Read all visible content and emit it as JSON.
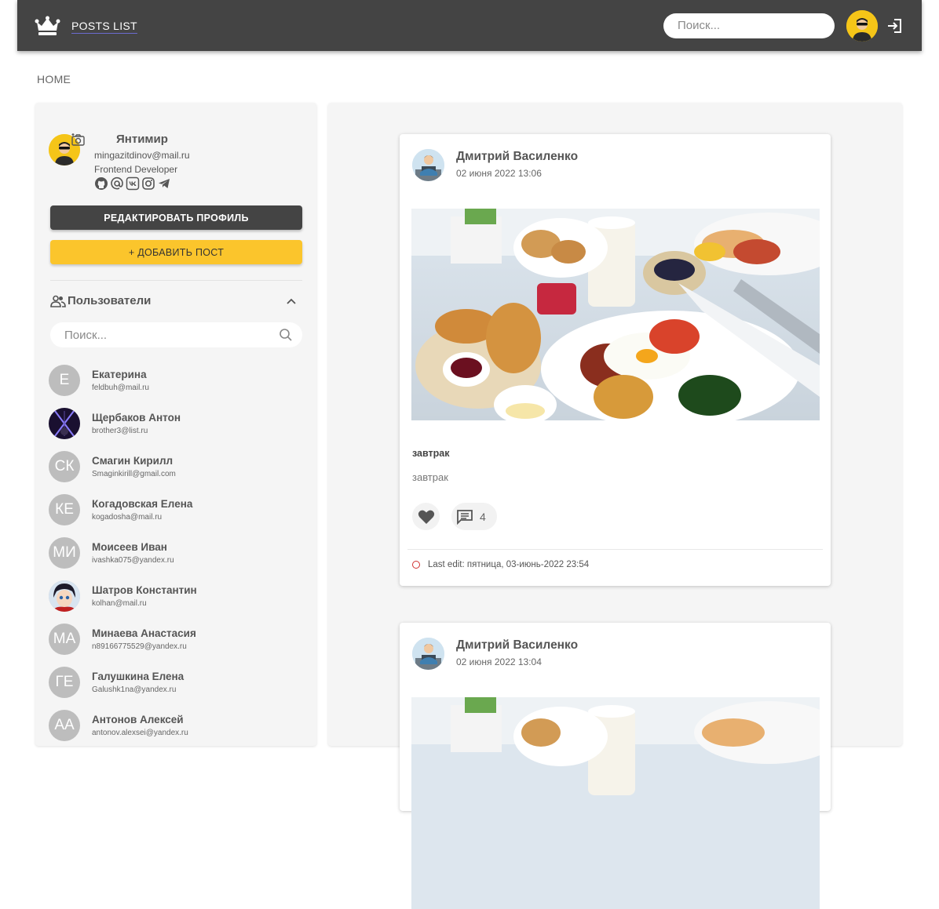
{
  "appbar": {
    "title": "POSTS LIST",
    "search_placeholder": "Поиск...",
    "icons": [
      "crown-logo-icon",
      "search-icon",
      "avatar",
      "logout-icon"
    ]
  },
  "breadcrumb": "HOME",
  "profile": {
    "name": "Янтимир",
    "email": "mingazitdinov@mail.ru",
    "role": "Frontend Developer",
    "socials": [
      "github-icon",
      "email-at-icon",
      "vk-icon",
      "instagram-icon",
      "telegram-icon"
    ],
    "edit_button": "РЕДАКТИРОВАТЬ ПРОФИЛЬ",
    "add_post_button": "+ ДОБАВИТЬ ПОСТ"
  },
  "users_section": {
    "title": "Пользователи",
    "search_placeholder": "Поиск...",
    "users": [
      {
        "name": "Екатерина",
        "email": "feldbuh@mail.ru",
        "initials": "Е",
        "photo": false
      },
      {
        "name": "Щербаков Антон",
        "email": "brother3@list.ru",
        "initials": "",
        "photo": "neon"
      },
      {
        "name": "Смагин Кирилл",
        "email": "Smaginkirill@gmail.com",
        "initials": "СК",
        "photo": false
      },
      {
        "name": "Когадовская Елена",
        "email": "kogadosha@mail.ru",
        "initials": "КЕ",
        "photo": false
      },
      {
        "name": "Моисеев Иван",
        "email": "ivashka075@yandex.ru",
        "initials": "МИ",
        "photo": false
      },
      {
        "name": "Шатров Константин",
        "email": "kolhan@mail.ru",
        "initials": "",
        "photo": "anime"
      },
      {
        "name": "Минаева Анастасия",
        "email": "n89166775529@yandex.ru",
        "initials": "МА",
        "photo": false
      },
      {
        "name": "Галушкина Елена",
        "email": "Galushk1na@yandex.ru",
        "initials": "ГЕ",
        "photo": false
      },
      {
        "name": "Антонов Алексей",
        "email": "antonov.alexsei@yandex.ru",
        "initials": "АА",
        "photo": false
      }
    ]
  },
  "posts": [
    {
      "author": "Дмитрий Василенко",
      "date": "02 июня 2022 13:06",
      "title": "завтрак",
      "text": "завтрак",
      "comments": "4",
      "last_edit": "Last edit: пятница, 03-июнь-2022 23:54"
    },
    {
      "author": "Дмитрий Василенко",
      "date": "02 июня 2022 13:04"
    }
  ],
  "colors": {
    "appbar": "#444444",
    "accent_yellow": "#fbc52c",
    "panel": "#f5f5f5",
    "edit_dot": "#d03030"
  }
}
